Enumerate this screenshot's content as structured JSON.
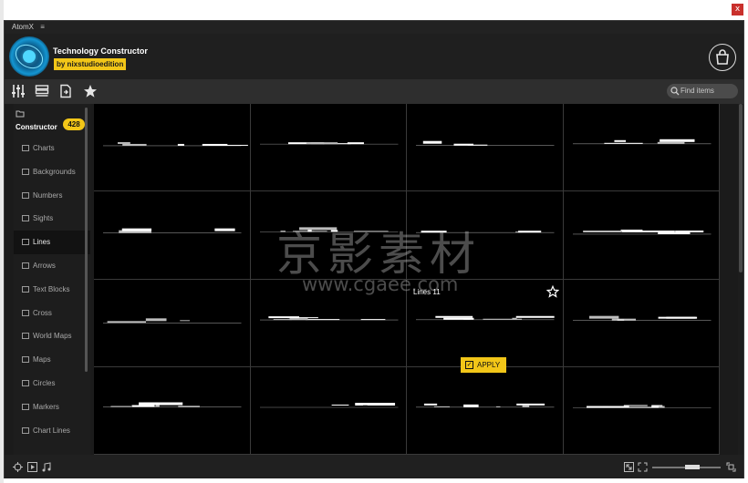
{
  "window": {
    "close_label": "x"
  },
  "menubar": {
    "app_name": "AtomX",
    "menu_icon": "hamburger-icon"
  },
  "header": {
    "title": "Technology Constructor",
    "byline": "by nixstudioedition",
    "bag_icon": "shopping-bag-icon"
  },
  "toolbar": {
    "icons": [
      "sliders-icon",
      "list-icon",
      "file-import-icon",
      "star-icon"
    ],
    "search_placeholder": "Find items"
  },
  "sidebar": {
    "heading": "Constructor",
    "count": "428",
    "items": [
      {
        "label": "Charts",
        "active": false
      },
      {
        "label": "Backgrounds",
        "active": false
      },
      {
        "label": "Numbers",
        "active": false
      },
      {
        "label": "Sights",
        "active": false
      },
      {
        "label": "Lines",
        "active": true
      },
      {
        "label": "Arrows",
        "active": false
      },
      {
        "label": "Text Blocks",
        "active": false
      },
      {
        "label": "Cross",
        "active": false
      },
      {
        "label": "World Maps",
        "active": false
      },
      {
        "label": "Maps",
        "active": false
      },
      {
        "label": "Circles",
        "active": false
      },
      {
        "label": "Markers",
        "active": false
      },
      {
        "label": "Chart Lines",
        "active": false
      }
    ]
  },
  "grid": {
    "hover_label": "Lines 11",
    "apply_label": "APPLY"
  },
  "watermark": {
    "text": "京影素材",
    "url": "www.cgaee.com"
  },
  "statusbar": {
    "icons": [
      "locate-icon",
      "play-icon",
      "music-icon",
      "collapse-icon",
      "expand-icon",
      "fullscreen-icon"
    ]
  }
}
